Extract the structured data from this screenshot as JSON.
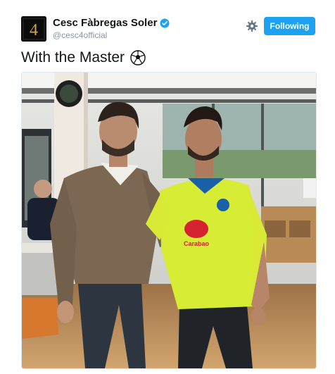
{
  "tweet": {
    "author": {
      "display_name": "Cesc Fàbregas Soler",
      "handle": "@cesc4official",
      "avatar_text": "4",
      "verified": true
    },
    "follow_button_label": "Following",
    "text": "With the Master",
    "emoji": "soccer-ball-icon"
  },
  "photo": {
    "shirt_text": "Carabao"
  },
  "colors": {
    "accent": "#1da1f2",
    "name": "#14171a",
    "handle": "#8899a6"
  }
}
